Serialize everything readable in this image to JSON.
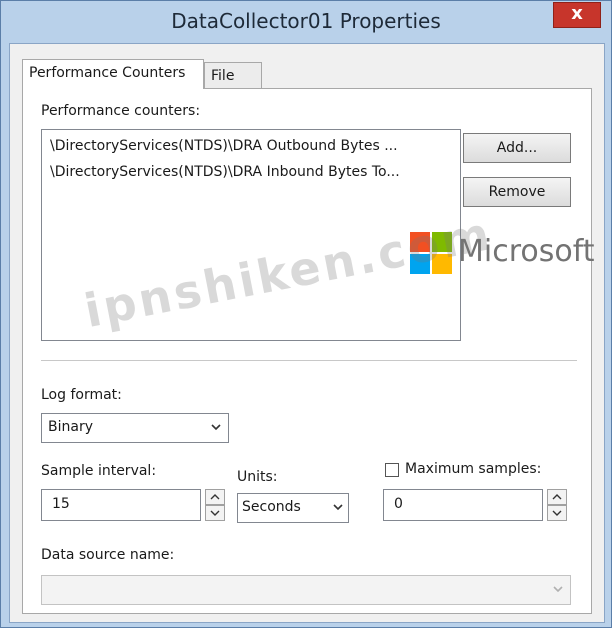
{
  "window": {
    "title": "DataCollector01 Properties",
    "close_label": "x"
  },
  "tabs": [
    {
      "label": "Performance Counters",
      "active": true
    },
    {
      "label": "File",
      "active": false
    }
  ],
  "counters": {
    "label": "Performance counters:",
    "items": [
      "\\DirectoryServices(NTDS)\\DRA Outbound Bytes ...",
      "\\DirectoryServices(NTDS)\\DRA Inbound Bytes To..."
    ],
    "add_label": "Add...",
    "remove_label": "Remove"
  },
  "log_format": {
    "label": "Log format:",
    "value": "Binary"
  },
  "sample_interval": {
    "label": "Sample interval:",
    "value": "15"
  },
  "units": {
    "label": "Units:",
    "value": "Seconds"
  },
  "maximum_samples": {
    "label": "Maximum samples:",
    "value": "0",
    "checked": false
  },
  "data_source": {
    "label": "Data source name:",
    "value": ""
  },
  "overlays": {
    "brand": "Microsoft",
    "watermark": "ipnshiken.com"
  },
  "colors": {
    "title_bg": "#b9d1ea",
    "close_bg": "#c7352b",
    "panel_bg": "#ffffff"
  },
  "logo_colors": [
    "#f25022",
    "#7fba00",
    "#00a4ef",
    "#ffb900"
  ]
}
